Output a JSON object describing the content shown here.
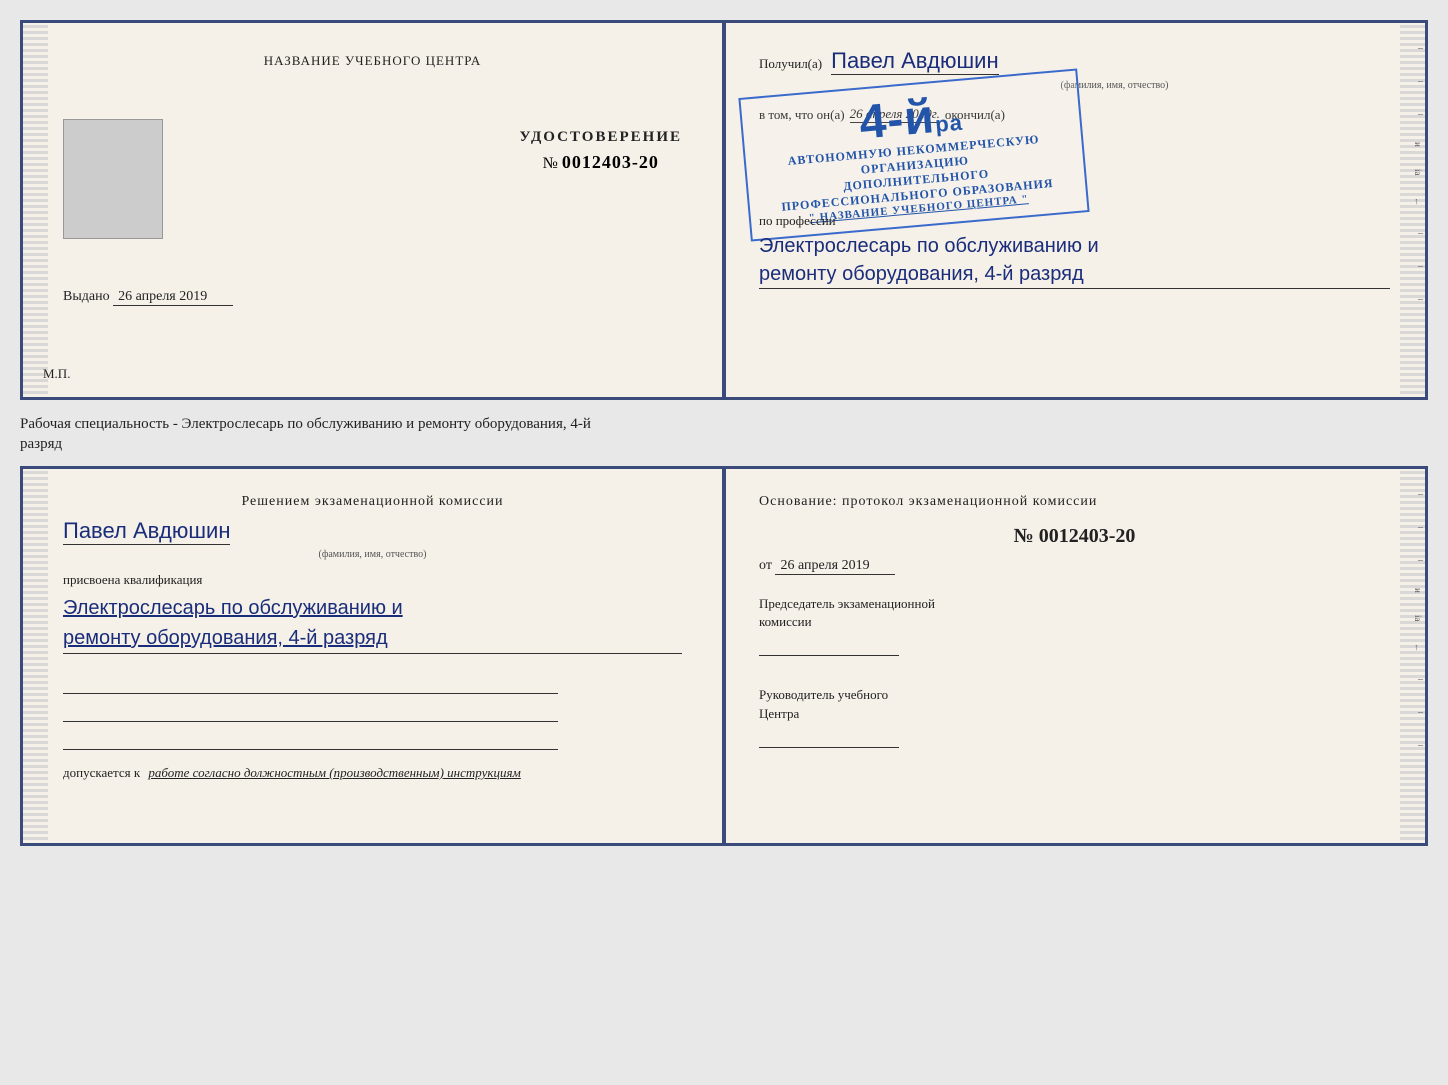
{
  "top_cert": {
    "left": {
      "org_name": "НАЗВАНИЕ УЧЕБНОГО ЦЕНТРА",
      "cert_title": "УДОСТОВЕРЕНИЕ",
      "cert_number_label": "№",
      "cert_number": "0012403-20",
      "issue_label": "Выдано",
      "issue_date": "26 апреля 2019",
      "mp_label": "М.П."
    },
    "right": {
      "recipient_prefix": "Получил(а)",
      "recipient_name": "Павел Авдюшин",
      "fio_label": "(фамилия, имя, отчество)",
      "completed_prefix": "в том, что он(а)",
      "completed_date": "26 апреля 2019г.",
      "completed_suffix": "окончил(а)",
      "org_line1": "АВТОНОМНУЮ НЕКОММЕРЧЕСКУЮ ОРГАНИЗАЦИЮ",
      "org_line2": "ДОПОЛНИТЕЛЬНОГО ПРОФЕССИОНАЛЬНОГО ОБРАЗОВАНИЯ",
      "org_name_stamp": "\" НАЗВАНИЕ УЧЕБНОГО ЦЕНТРА \"",
      "profession_label": "по профессии",
      "profession_text_line1": "Электрослесарь по обслуживанию и",
      "profession_text_line2": "ремонту оборудования, 4-й разряд",
      "grade": "4-й",
      "grade_suffix": "ра"
    }
  },
  "between_label": {
    "line1": "Рабочая специальность - Электрослесарь по обслуживанию и ремонту оборудования, 4-й",
    "line2": "разряд"
  },
  "bottom_cert": {
    "left": {
      "commission_title": "Решением экзаменационной комиссии",
      "person_name": "Павел Авдюшин",
      "fio_label": "(фамилия, имя, отчество)",
      "assigned_label": "присвоена квалификация",
      "qual_line1": "Электрослесарь по обслуживанию и",
      "qual_line2": "ремонту оборудования, 4-й разряд",
      "допускается_prefix": "допускается к",
      "допускается_text": "работе согласно должностным (производственным) инструкциям"
    },
    "right": {
      "basis_title": "Основание: протокол экзаменационной комиссии",
      "number_prefix": "№",
      "number": "0012403-20",
      "from_prefix": "от",
      "from_date": "26 апреля 2019",
      "chairman_line1": "Председатель экзаменационной",
      "chairman_line2": "комиссии",
      "head_line1": "Руководитель учебного",
      "head_line2": "Центра"
    }
  },
  "right_marks": {
    "dash1": "–",
    "dash2": "–",
    "dash3": "–",
    "label_i": "и",
    "label_ia": "ia",
    "label_arrow": "←",
    "dash4": "–",
    "dash5": "–",
    "dash6": "–"
  }
}
